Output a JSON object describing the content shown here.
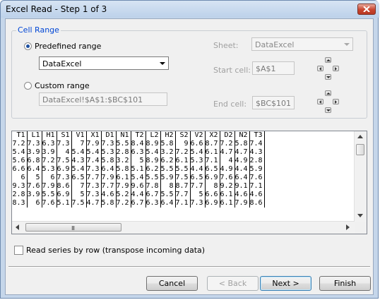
{
  "window": {
    "title": "Excel Read - Step 1 of 3"
  },
  "cell_range": {
    "legend": "Cell Range",
    "predefined_label": "Predefined range",
    "predefined_selected": true,
    "predefined_value": "DataExcel",
    "custom_label": "Custom range",
    "custom_value": "DataExcel!$A$1:$BC$101",
    "sheet_label": "Sheet:",
    "sheet_value": "DataExcel",
    "start_label": "Start cell:",
    "start_value": "$A$1",
    "end_label": "End cell:",
    "end_value": "$BC$101"
  },
  "grid": {
    "headers": [
      "T1",
      "L1",
      "H1",
      "S1",
      "V1",
      "X1",
      "D1",
      "N1",
      "T2",
      "L2",
      "H2",
      "S2",
      "V2",
      "X2",
      "D2",
      "N2",
      "T3"
    ],
    "rows": [
      [
        "7.2",
        "7.3",
        "6.3",
        "7.3",
        "7",
        "7.9",
        "7.3",
        "5.5",
        "8.4",
        "8.9",
        "5.8",
        "9",
        "6.6",
        "8.7",
        "7.2",
        "5.8",
        "7.4"
      ],
      [
        "5.4",
        "3.9",
        "3.9",
        "4",
        "5.4",
        "5.4",
        "5.3",
        "2.8",
        "6.3",
        "5.4",
        "3.2",
        "7.2",
        "5.4",
        "6.1",
        "4.7",
        "4.7",
        "4.3"
      ],
      [
        "5.6",
        "6.8",
        "7.2",
        "7.5",
        "4.3",
        "7.4",
        "5.8",
        "3.2",
        "5",
        "8.9",
        "6.2",
        "6.1",
        "5.3",
        "7.1",
        "4",
        "4.9",
        "2.8"
      ],
      [
        "6.6",
        "6.4",
        "5.3",
        "6.9",
        "5.4",
        "7.3",
        "6.4",
        "5.8",
        "5.1",
        "6.2",
        "5.5",
        "5.5",
        "4.4",
        "6.5",
        "4.9",
        "4.4",
        "5.9"
      ],
      [
        "6",
        "5",
        "6",
        "7.3",
        "6.5",
        "7.7",
        "7.9",
        "6.1",
        "5.4",
        "5.5",
        "5.9",
        "7.5",
        "6.5",
        "6.9",
        "7.6",
        "6.4",
        "7.6"
      ],
      [
        "9.3",
        "7.6",
        "7.9",
        "8.6",
        "7",
        "7.3",
        "7.7",
        "7.9",
        "9.6",
        "7.8",
        "8",
        "8.7",
        "7.7",
        "8",
        "9.2",
        "9.1",
        "7.1"
      ],
      [
        "2.8",
        "3.9",
        "5.5",
        "6.9",
        "5",
        "7.3",
        "4.6",
        "5.2",
        "4.4",
        "6.7",
        "5.5",
        "7.7",
        "5",
        "6.6",
        "6.1",
        "4.6",
        "4.6"
      ],
      [
        "8.3",
        "6",
        "7.6",
        "5.1",
        "7.5",
        "4.7",
        "5.8",
        "7.2",
        "6.7",
        "6.3",
        "6.4",
        "7.1",
        "7.3",
        "6.9",
        "6.1",
        "7.9",
        "8.6"
      ]
    ],
    "hscroll_grip": "III"
  },
  "options": {
    "transpose_label": "Read series by row (transpose incoming data)",
    "transpose_checked": false
  },
  "buttons": {
    "cancel": "Cancel",
    "back": "< Back",
    "next": "Next >",
    "finish": "Finish"
  },
  "colors": {
    "legend": "#0046d5",
    "close_button": "#c9452f",
    "default_button_border": "#3c7fb1"
  }
}
